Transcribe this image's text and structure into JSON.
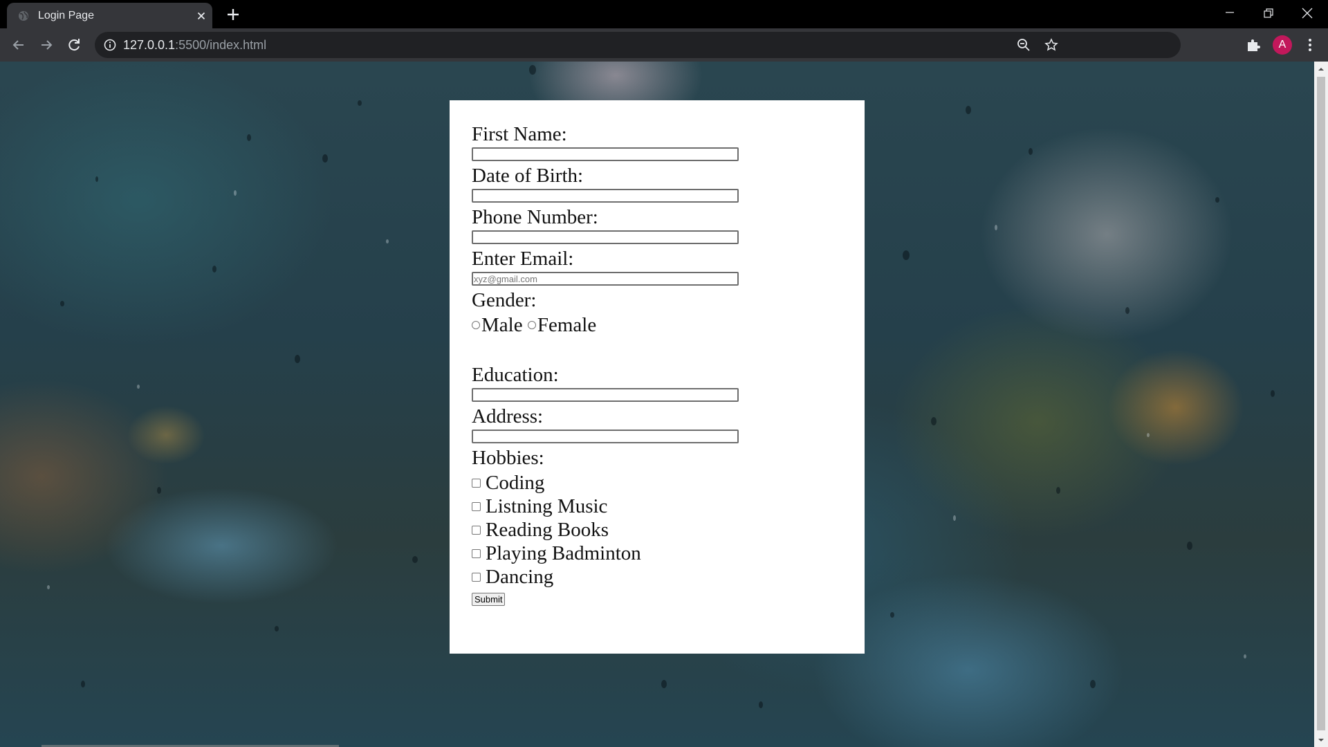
{
  "browser": {
    "tab_title": "Login Page",
    "url_host": "127.0.0.1",
    "url_path": ":5500/index.html",
    "profile_initial": "A"
  },
  "form": {
    "first_name_label": "First Name:",
    "dob_label": "Date of Birth:",
    "phone_label": "Phone Number:",
    "email_label": "Enter Email:",
    "email_placeholder": "xyz@gmail.com",
    "gender_label": "Gender:",
    "gender_options": [
      "Male",
      "Female"
    ],
    "education_label": "Education:",
    "address_label": "Address:",
    "hobbies_label": "Hobbies:",
    "hobbies": [
      "Coding",
      "Listning Music",
      "Reading Books",
      "Playing Badminton",
      "Dancing"
    ],
    "submit_label": "Submit"
  }
}
